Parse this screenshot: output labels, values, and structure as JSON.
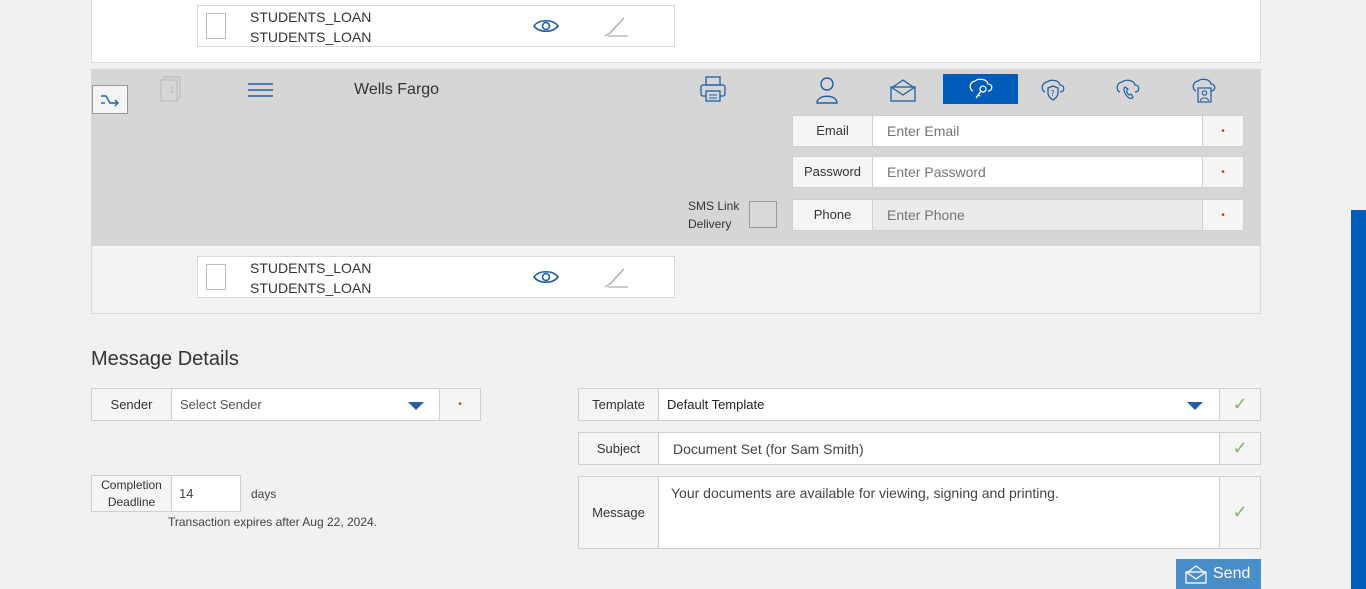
{
  "top_doc": {
    "name1": "STUDENTS_LOAN",
    "name2": "STUDENTS_LOAN"
  },
  "signer": {
    "name": "Wells Fargo",
    "tabs": [
      "person-icon",
      "envelope-icon",
      "key-icon",
      "shield-question-icon",
      "phone-icon",
      "cloud-user-icon"
    ],
    "active_tab": "key-icon",
    "email_label": "Email",
    "email_placeholder": "Enter Email",
    "password_label": "Password",
    "password_placeholder": "Enter Password",
    "sms_label_1": "SMS Link",
    "sms_label_2": "Delivery",
    "phone_label": "Phone",
    "phone_placeholder": "Enter Phone",
    "required_mark": "•"
  },
  "bottom_doc": {
    "name1": "STUDENTS_LOAN",
    "name2": "STUDENTS_LOAN"
  },
  "message_details": {
    "title": "Message Details",
    "sender_label": "Sender",
    "sender_value": "Select Sender",
    "completion_label_1": "Completion",
    "completion_label_2": "Deadline",
    "completion_value": "14",
    "days_label": "days",
    "expires_text": "Transaction expires after Aug 22, 2024.",
    "template_label": "Template",
    "template_value": "Default Template",
    "subject_label": "Subject",
    "subject_value": "Document Set (for Sam Smith)",
    "message_label": "Message",
    "message_value": "Your documents are available for viewing, signing and printing.",
    "check_mark": "✓",
    "send_label": "Send"
  },
  "colors": {
    "accent": "#005cb9",
    "send_bg": "#4a8ec9",
    "panel": "#d6d6d6"
  }
}
